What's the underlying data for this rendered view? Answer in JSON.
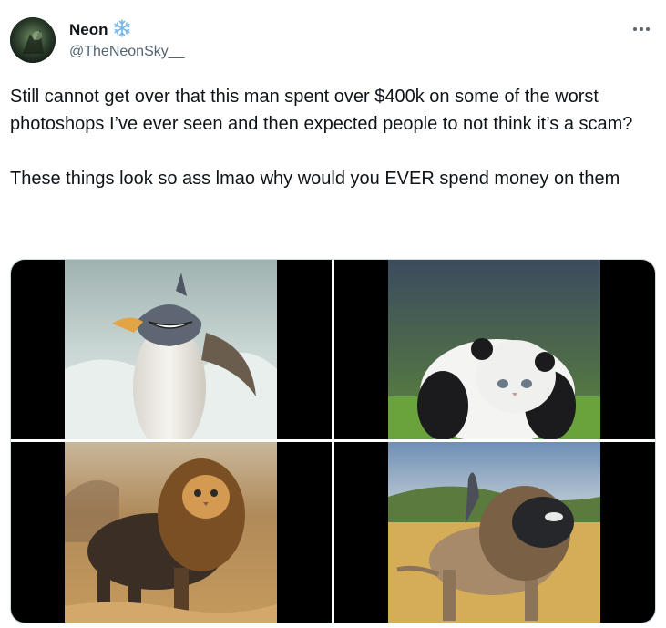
{
  "author": {
    "display_name": "Neon",
    "badge_icon": "snowflake-icon",
    "handle": "@TheNeonSky__"
  },
  "menu_icon": "more-options-icon",
  "tweet": {
    "paragraph_1": "Still cannot get over that this man spent over $400k on some of the worst photoshops I’ve ever seen and then expected people to not think it’s a scam?",
    "paragraph_2": "These things look so ass lmao why would you EVER spend money on them"
  },
  "media": [
    {
      "subject": "penguin-with-shark-head"
    },
    {
      "subject": "panda-with-cat-face"
    },
    {
      "subject": "lion-with-cat-face"
    },
    {
      "subject": "lion-with-orca-head"
    }
  ],
  "colors": {
    "text": "#0f1419",
    "secondary": "#536471",
    "badge": "#7ab6e8"
  }
}
